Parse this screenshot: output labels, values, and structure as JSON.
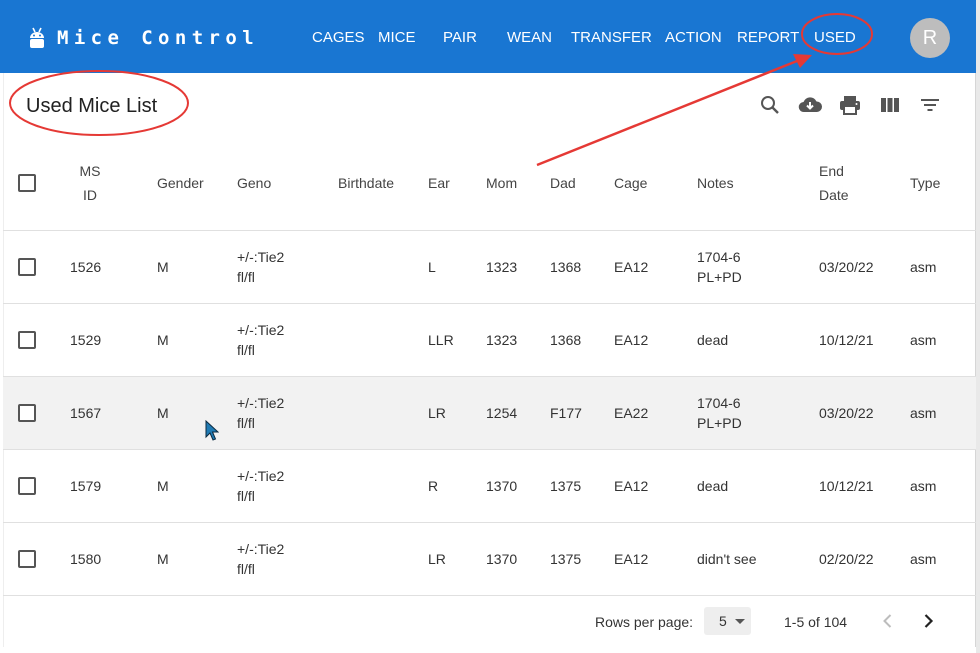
{
  "app": {
    "title": "Mice Control",
    "avatar_initial": "R",
    "accent_color": "#1976d2",
    "icon": "android-robot-icon"
  },
  "nav": {
    "items": [
      {
        "label": "CAGES"
      },
      {
        "label": "MICE"
      },
      {
        "label": "PAIR"
      },
      {
        "label": "WEAN"
      },
      {
        "label": "TRANSFER"
      },
      {
        "label": "ACTION"
      },
      {
        "label": "REPORT"
      },
      {
        "label": "USED"
      }
    ]
  },
  "page": {
    "title": "Used Mice List"
  },
  "toolbar": {
    "icons": [
      "search-icon",
      "cloud-download-icon",
      "print-icon",
      "view-columns-icon",
      "filter-list-icon"
    ]
  },
  "table": {
    "headers": {
      "ms_id_line1": "MS",
      "ms_id_line2": "ID",
      "gender": "Gender",
      "geno": "Geno",
      "birthdate": "Birthdate",
      "ear": "Ear",
      "mom": "Mom",
      "dad": "Dad",
      "cage": "Cage",
      "notes": "Notes",
      "end_date_line1": "End",
      "end_date_line2": "Date",
      "type": "Type"
    },
    "rows": [
      {
        "ms_id": "1526",
        "gender": "M",
        "geno_line1": "+/-:Tie2",
        "geno_line2": "fl/fl",
        "birthdate": "",
        "ear": "L",
        "mom": "1323",
        "dad": "1368",
        "cage": "EA12",
        "notes_line1": "1704-6",
        "notes_line2": "PL+PD",
        "end_date": "03/20/22",
        "type": "asm"
      },
      {
        "ms_id": "1529",
        "gender": "M",
        "geno_line1": "+/-:Tie2",
        "geno_line2": "fl/fl",
        "birthdate": "",
        "ear": "LLR",
        "mom": "1323",
        "dad": "1368",
        "cage": "EA12",
        "notes_line1": "dead",
        "notes_line2": "",
        "end_date": "10/12/21",
        "type": "asm"
      },
      {
        "ms_id": "1567",
        "gender": "M",
        "geno_line1": "+/-:Tie2",
        "geno_line2": "fl/fl",
        "birthdate": "",
        "ear": "LR",
        "mom": "1254",
        "dad": "F177",
        "cage": "EA22",
        "notes_line1": "1704-6",
        "notes_line2": "PL+PD",
        "end_date": "03/20/22",
        "type": "asm"
      },
      {
        "ms_id": "1579",
        "gender": "M",
        "geno_line1": "+/-:Tie2",
        "geno_line2": "fl/fl",
        "birthdate": "",
        "ear": "R",
        "mom": "1370",
        "dad": "1375",
        "cage": "EA12",
        "notes_line1": "dead",
        "notes_line2": "",
        "end_date": "10/12/21",
        "type": "asm"
      },
      {
        "ms_id": "1580",
        "gender": "M",
        "geno_line1": "+/-:Tie2",
        "geno_line2": "fl/fl",
        "birthdate": "",
        "ear": "LR",
        "mom": "1370",
        "dad": "1375",
        "cage": "EA12",
        "notes_line1": "didn't see",
        "notes_line2": "",
        "end_date": "02/20/22",
        "type": "asm"
      }
    ]
  },
  "pagination": {
    "rows_per_page_label": "Rows per page:",
    "rows_per_page_value": "5",
    "range_text": "1-5 of 104"
  },
  "annotations": {
    "color": "#e53935"
  }
}
